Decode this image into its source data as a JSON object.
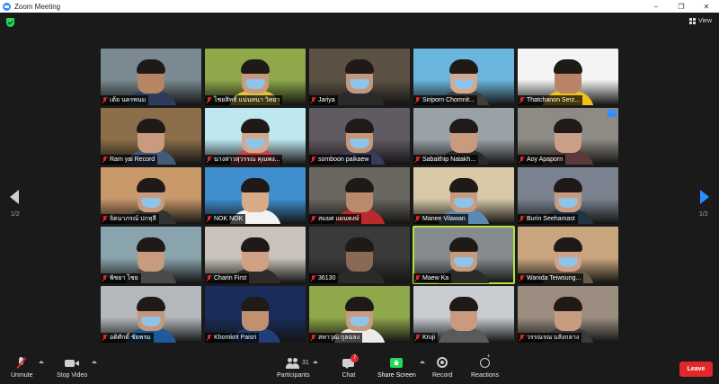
{
  "window": {
    "title": "Zoom Meeting",
    "minimize": "–",
    "restore": "❐",
    "close": "✕"
  },
  "topbar": {
    "view_label": "View"
  },
  "pagination": {
    "left": "1/2",
    "right": "1/2"
  },
  "participants": [
    {
      "name": "เต้ย นครพนม",
      "muted": true,
      "bg": "#7a8a90",
      "skin": "#b58564",
      "shirt": "#2c3c5a",
      "mask": false,
      "active": false
    },
    {
      "name": "ไชยสิทธิ์ แน่นหนา วิทยา",
      "muted": true,
      "bg": "#8ea84a",
      "skin": "#c99b7e",
      "shirt": "#e3c13a",
      "mask": true,
      "active": false
    },
    {
      "name": "Jariya",
      "muted": true,
      "bg": "#5b5245",
      "skin": "#c4967a",
      "shirt": "#2a2a2a",
      "mask": true,
      "active": false
    },
    {
      "name": "Siriporn Chomnit...",
      "muted": true,
      "bg": "#6ab6dd",
      "skin": "#d6a98b",
      "shirt": "#3e3e3e",
      "mask": true,
      "active": false
    },
    {
      "name": "Thatchanon Serz...",
      "muted": true,
      "bg": "#f4f4f4",
      "skin": "#b88366",
      "shirt": "#f2c019",
      "mask": false,
      "active": false
    },
    {
      "name": "Ram yai Record",
      "muted": true,
      "bg": "#8c6f4a",
      "skin": "#c99b7e",
      "shirt": "#445a7a",
      "mask": false,
      "active": false
    },
    {
      "name": "นางสาวสุวรรณ คุณพง...",
      "muted": true,
      "bg": "#bfe7ef",
      "skin": "#d5a88a",
      "shirt": "#c1444b",
      "mask": true,
      "active": false
    },
    {
      "name": "somboon paikaew",
      "muted": true,
      "bg": "#605a62",
      "skin": "#c49676",
      "shirt": "#3a3a5a",
      "mask": true,
      "active": false
    },
    {
      "name": "Sabaithip Natakh...",
      "muted": true,
      "bg": "#9aa2a8",
      "skin": "#c99b7e",
      "shirt": "#2a2a2a",
      "mask": false,
      "active": false
    },
    {
      "name": "Aoy Apaporn",
      "muted": true,
      "bg": "#8e8a84",
      "skin": "#caa088",
      "shirt": "#5a3a3a",
      "mask": false,
      "active": false,
      "more": "···"
    },
    {
      "name": "จิตนาภรณ์ ปกหุลี",
      "muted": true,
      "bg": "#c89868",
      "skin": "#c99b7e",
      "shirt": "#333333",
      "mask": true,
      "active": false
    },
    {
      "name": "NOK NOK",
      "muted": true,
      "bg": "#3f8fcf",
      "skin": "#d8aa86",
      "shirt": "#f2f2f2",
      "mask": false,
      "active": false
    },
    {
      "name": "สมยศ แผนพงษ์",
      "muted": true,
      "bg": "#6a6660",
      "skin": "#bb8a6c",
      "shirt": "#bb2a2a",
      "mask": false,
      "active": false
    },
    {
      "name": "Manee Vilawan",
      "muted": true,
      "bg": "#d8c9a8",
      "skin": "#c99b7e",
      "shirt": "#5a8ab4",
      "mask": true,
      "active": false
    },
    {
      "name": "Burin Seehamast",
      "muted": true,
      "bg": "#7a8290",
      "skin": "#c99b7e",
      "shirt": "#223344",
      "mask": true,
      "active": false
    },
    {
      "name": "พิชยา ไชย",
      "muted": true,
      "bg": "#8aa4ad",
      "skin": "#c99b7e",
      "shirt": "#4a4a4a",
      "mask": false,
      "active": false
    },
    {
      "name": "Charin First",
      "muted": true,
      "bg": "#c9c3bb",
      "skin": "#d0a184",
      "shirt": "#302a28",
      "mask": false,
      "active": false
    },
    {
      "name": "36130",
      "muted": true,
      "bg": "#3a3a3a",
      "skin": "#8a6a55",
      "shirt": "#2a2a2a",
      "mask": false,
      "active": false
    },
    {
      "name": "Maew Ka",
      "muted": true,
      "bg": "#858b8e",
      "skin": "#c99b7e",
      "shirt": "#2a2a2a",
      "mask": true,
      "active": true
    },
    {
      "name": "Wanida Teiwsung...",
      "muted": true,
      "bg": "#c9a67e",
      "skin": "#d0a184",
      "shirt": "#6a5a4a",
      "mask": true,
      "active": false
    },
    {
      "name": "อดิศักดิ์ ชัยพรม",
      "muted": true,
      "bg": "#b4b8bd",
      "skin": "#c4967a",
      "shirt": "#1f5a9a",
      "mask": true,
      "active": false
    },
    {
      "name": "Khomkrit Paisri",
      "muted": true,
      "bg": "#1a2d5a",
      "skin": "#c19070",
      "shirt": "#1f3e7a",
      "mask": false,
      "active": false
    },
    {
      "name": "สหาวุฒิ กุลฉลง",
      "muted": true,
      "bg": "#8fa84a",
      "skin": "#c99b7e",
      "shirt": "#ebebeb",
      "mask": true,
      "active": false
    },
    {
      "name": "Kruji",
      "muted": true,
      "bg": "#c9cdd2",
      "skin": "#c99b7e",
      "shirt": "#5a5a5a",
      "mask": false,
      "active": false
    },
    {
      "name": "วรรณรณ บลังกลาง",
      "muted": true,
      "bg": "#9b8e80",
      "skin": "#c99b7e",
      "shirt": "#3a3a3a",
      "mask": false,
      "active": false
    }
  ],
  "toolbar": {
    "unmute": "Unmute",
    "stop_video": "Stop Video",
    "participants": "Participants",
    "participants_count": "31",
    "chat": "Chat",
    "chat_badge": "7",
    "share_screen": "Share Screen",
    "record": "Record",
    "reactions": "Reactions",
    "leave": "Leave"
  }
}
